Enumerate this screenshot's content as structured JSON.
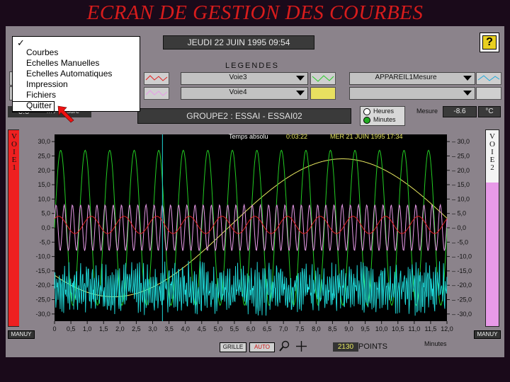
{
  "slide_title": "ECRAN DE GESTION DES COURBES",
  "colors": {
    "red": "#e02020",
    "green": "#22cc22",
    "yellow": "#e8e860",
    "pink": "#e89ae8",
    "cyan": "#20e0e0",
    "panel": "#8b838b",
    "plot_bg": "#000000"
  },
  "header": {
    "datetime": "JEUDI 22 JUIN 1995 09:54",
    "help_icon": "question-mark-icon",
    "legends_label": "LEGENDES"
  },
  "menu": {
    "check": "✓",
    "items": [
      "Courbes",
      "Echelles Manuelles",
      "Echelles Automatiques",
      "Impression",
      "Fichiers",
      "Quitter"
    ]
  },
  "legend": {
    "row1": {
      "voie": "Voie3",
      "appareil": "APPAREIL1Mesure"
    },
    "row2": {
      "voie": "Voie4",
      "appareil": ""
    }
  },
  "group": {
    "title": "GROUPE2 : ESSAI - ESSAI02",
    "left_value": "3.8",
    "left_label": "mV Mesure"
  },
  "time_mode": {
    "hours": "Heures",
    "minutes": "Minutes",
    "selected": "Minutes"
  },
  "mesure": {
    "label": "Mesure",
    "value": "-8.6",
    "unit": "°C"
  },
  "plot_header": {
    "mode": "Temps absolu",
    "elapsed": "0:03:22",
    "date": "MER 21 JUIN 1995 17:34"
  },
  "left_strip": "VOIE1",
  "right_strip": "VOIE2",
  "manu_left": "MANUY",
  "manu_right": "MANUY",
  "bottom": {
    "grille": "GRILLE",
    "auto": "AUTO",
    "points_value": "2130",
    "points_label": "POINTS",
    "x_unit": "Minutes"
  },
  "chart_data": {
    "type": "line",
    "x_unit": "Minutes",
    "xlim": [
      0,
      12
    ],
    "ylim": [
      -32.5,
      32.5
    ],
    "xticks": [
      "0",
      "0,5",
      "1,0",
      "1,5",
      "2,0",
      "2,5",
      "3,0",
      "3,5",
      "4,0",
      "4,5",
      "5,0",
      "5,5",
      "6,0",
      "6,5",
      "7,0",
      "7,5",
      "8,0",
      "8,5",
      "9,0",
      "9,5",
      "10,0",
      "10,5",
      "11,0",
      "11,5",
      "12,0"
    ],
    "yticks_left": [
      "30,0",
      "25,0",
      "20,0",
      "15,0",
      "10,0",
      "5,0",
      "0,0",
      "-5,0",
      "-10,0",
      "-15,0",
      "-20,0",
      "-25,0",
      "-30,0"
    ],
    "yticks_right": [
      "30,0",
      "25,0",
      "20,0",
      "15,0",
      "10,0",
      "5,0",
      "0,0",
      "-5,0",
      "-10,0",
      "-15,0",
      "-20,0",
      "-25,0",
      "-30,0"
    ],
    "cursor_x": 3.3,
    "series": [
      {
        "color": "#e8e860",
        "amplitude": 24,
        "offset": 0,
        "period": 14,
        "phase": 3.9
      },
      {
        "color": "#22cc22",
        "amplitude": 27,
        "offset": 0,
        "period": 0.75,
        "phase": 0
      },
      {
        "color": "#e89ae8",
        "amplitude": 8,
        "offset": 0,
        "period": 0.25,
        "phase": 0.4
      },
      {
        "color": "#e02020",
        "amplitude": 3,
        "offset": 1,
        "period": 1,
        "phase": 0.8
      },
      {
        "color": "#20e0e0",
        "amplitude": 5,
        "offset": -21,
        "period": 0.06,
        "noise": 3
      }
    ]
  }
}
